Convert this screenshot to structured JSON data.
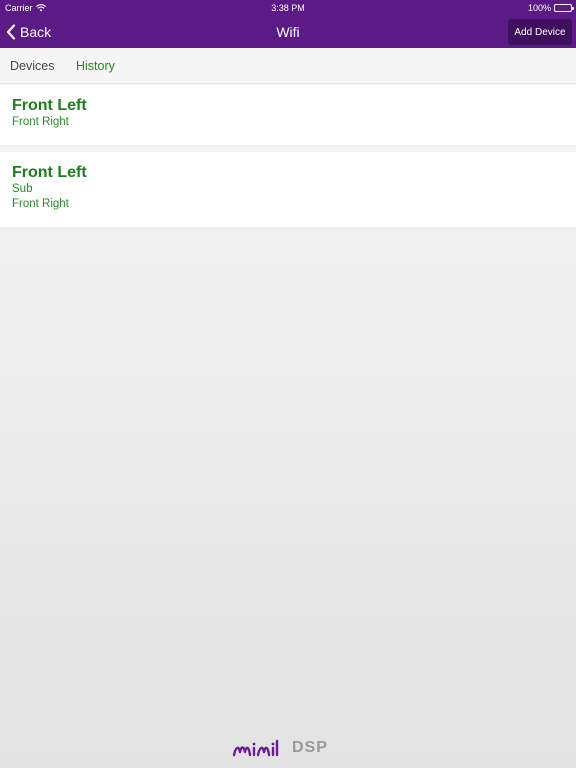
{
  "status_bar": {
    "carrier": "Carrier",
    "time": "3:38 PM",
    "battery": "100%"
  },
  "nav": {
    "back_label": "Back",
    "title": "Wifi",
    "add_device_label": "Add Device"
  },
  "tabs": [
    {
      "label": "Devices",
      "active": false
    },
    {
      "label": "History",
      "active": true
    }
  ],
  "history": [
    {
      "title": "Front Left",
      "lines": [
        "Front Right"
      ]
    },
    {
      "title": "Front Left",
      "lines": [
        "Sub",
        "Front Right"
      ]
    }
  ],
  "logo": {
    "text": "DSP"
  },
  "colors": {
    "header": "#5c1a87",
    "add_button": "#3f0f5f",
    "accent_green": "#1c7f1c",
    "logo_purple": "#6a1b9a"
  },
  "icons": [
    "wifi-icon",
    "battery-icon",
    "chevron-left-icon"
  ]
}
